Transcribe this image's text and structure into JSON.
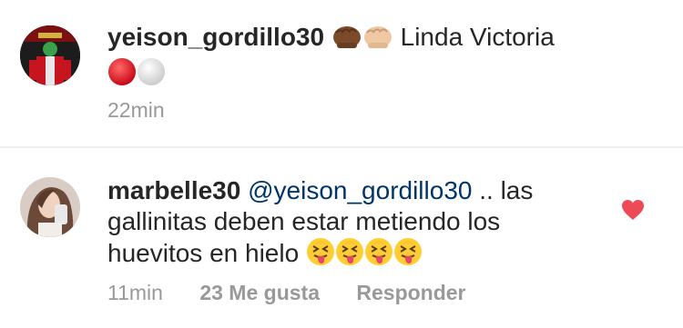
{
  "comment1": {
    "username": "yeison_gordillo30",
    "text": "Linda Victoria",
    "time": "22min"
  },
  "comment2": {
    "username": "marbelle30",
    "mention": "@yeison_gordillo30",
    "text": " .. las gallinitas deben estar metiendo los huevitos en hielo ",
    "time": "11min",
    "likes": "23 Me gusta",
    "reply_label": "Responder"
  },
  "icons": {
    "fist_dark": "fist-icon",
    "fist_light": "fist-icon",
    "red_circle": "red-circle-icon",
    "white_circle": "white-circle-icon",
    "tongue_face": "squinting-tongue-face-icon",
    "heart": "heart-icon"
  },
  "colors": {
    "username": "#262626",
    "mention": "#003569",
    "meta": "#999999",
    "heart": "#ed4956"
  }
}
